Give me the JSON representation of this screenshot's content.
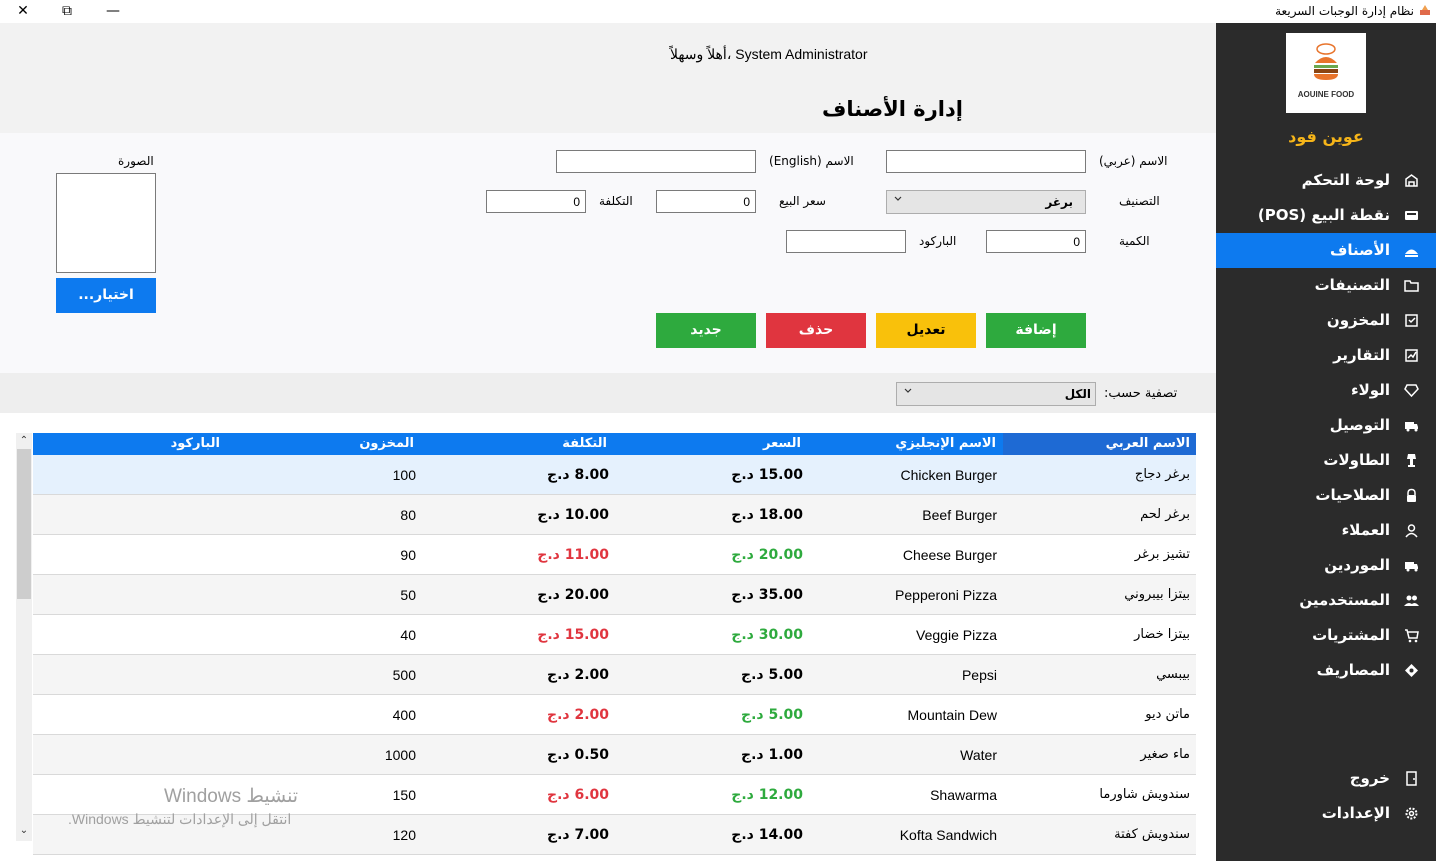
{
  "window": {
    "title": "نظام إدارة الوجبات السريعة",
    "close_glyph": "✕",
    "restore_glyph": "⧉",
    "minimize_glyph": "—"
  },
  "sidebar": {
    "logo_text": "AOUINE FOOD",
    "brand": "عوين فود",
    "items": [
      {
        "label": "لوحة التحكم",
        "icon": "dashboard-icon"
      },
      {
        "label": "نقطة البيع (POS)",
        "icon": "pos-icon"
      },
      {
        "label": "الأصناف",
        "icon": "items-icon"
      },
      {
        "label": "التصنيفات",
        "icon": "folder-icon"
      },
      {
        "label": "المخزون",
        "icon": "inventory-icon"
      },
      {
        "label": "التقارير",
        "icon": "reports-icon"
      },
      {
        "label": "الولاء",
        "icon": "loyalty-icon"
      },
      {
        "label": "التوصيل",
        "icon": "delivery-icon"
      },
      {
        "label": "الطاولات",
        "icon": "tables-icon"
      },
      {
        "label": "الصلاحيات",
        "icon": "lock-icon"
      },
      {
        "label": "العملاء",
        "icon": "customers-icon"
      },
      {
        "label": "الموردين",
        "icon": "suppliers-icon"
      },
      {
        "label": "المستخدمين",
        "icon": "users-icon"
      },
      {
        "label": "المشتريات",
        "icon": "purchases-icon"
      },
      {
        "label": "المصاريف",
        "icon": "expenses-icon"
      }
    ],
    "logout": "خروج",
    "settings": "الإعدادات",
    "active_color": "#0d7aef",
    "brand_color": "#f6b519"
  },
  "header": {
    "welcome": "أهلاً وسهلاً، System Administrator",
    "page_title": "إدارة الأصناف"
  },
  "form": {
    "name_ar_label": "الاسم (عربي)",
    "name_ar_value": "",
    "name_en_label": "الاسم (English)",
    "name_en_value": "",
    "category_label": "التصنيف",
    "category_value": "برغر",
    "price_label": "سعر البيع",
    "price_value": "0",
    "cost_label": "التكلفة",
    "cost_value": "0",
    "qty_label": "الكمية",
    "qty_value": "0",
    "barcode_label": "الباركود",
    "barcode_value": "",
    "image_label": "الصورة",
    "choose_button": "اختيار...",
    "add_button": "إضافة",
    "edit_button": "تعديل",
    "delete_button": "حذف",
    "new_button": "جديد"
  },
  "filter": {
    "label": "تصفية حسب:",
    "value": "الكل"
  },
  "grid": {
    "columns": [
      "الاسم العربي",
      "الاسم الإنجليزي",
      "السعر",
      "التكلفة",
      "المخزون",
      "الباركود"
    ],
    "rows": [
      {
        "ar": "برغر دجاج",
        "en": "Chicken Burger",
        "price": "15.00 د.ج",
        "cost": "8.00 د.ج",
        "stock": "100",
        "barcode": "",
        "price_color": "#000000",
        "cost_color": "#000000"
      },
      {
        "ar": "برغر لحم",
        "en": "Beef Burger",
        "price": "18.00 د.ج",
        "cost": "10.00 د.ج",
        "stock": "80",
        "barcode": "",
        "price_color": "#000000",
        "cost_color": "#000000"
      },
      {
        "ar": "تشيز برغر",
        "en": "Cheese Burger",
        "price": "20.00 د.ج",
        "cost": "11.00 د.ج",
        "stock": "90",
        "barcode": "",
        "price_color": "#2eaa3e",
        "cost_color": "#e0353f"
      },
      {
        "ar": "بيتزا بيبروني",
        "en": "Pepperoni Pizza",
        "price": "35.00 د.ج",
        "cost": "20.00 د.ج",
        "stock": "50",
        "barcode": "",
        "price_color": "#000000",
        "cost_color": "#000000"
      },
      {
        "ar": "بيتزا خضار",
        "en": "Veggie Pizza",
        "price": "30.00 د.ج",
        "cost": "15.00 د.ج",
        "stock": "40",
        "barcode": "",
        "price_color": "#2eaa3e",
        "cost_color": "#e0353f"
      },
      {
        "ar": "بيبسي",
        "en": "Pepsi",
        "price": "5.00 د.ج",
        "cost": "2.00 د.ج",
        "stock": "500",
        "barcode": "",
        "price_color": "#000000",
        "cost_color": "#000000"
      },
      {
        "ar": "ماتن ديو",
        "en": "Mountain Dew",
        "price": "5.00 د.ج",
        "cost": "2.00 د.ج",
        "stock": "400",
        "barcode": "",
        "price_color": "#2eaa3e",
        "cost_color": "#e0353f"
      },
      {
        "ar": "ماء صغير",
        "en": "Water",
        "price": "1.00 د.ج",
        "cost": "0.50 د.ج",
        "stock": "1000",
        "barcode": "",
        "price_color": "#000000",
        "cost_color": "#000000"
      },
      {
        "ar": "سندويش شاورما",
        "en": "Shawarma",
        "price": "12.00 د.ج",
        "cost": "6.00 د.ج",
        "stock": "150",
        "barcode": "",
        "price_color": "#2eaa3e",
        "cost_color": "#e0353f"
      },
      {
        "ar": "سندويش كفتة",
        "en": "Kofta Sandwich",
        "price": "14.00 د.ج",
        "cost": "7.00 د.ج",
        "stock": "120",
        "barcode": "",
        "price_color": "#000000",
        "cost_color": "#000000"
      }
    ],
    "header_color": "#0d7aef",
    "selected_row_color": "#e5f1fd",
    "alt_row_color": "#f5f5f5"
  },
  "watermark": {
    "line1": "تنشيط Windows",
    "line2": "انتقل إلى الإعدادات لتنشيط Windows."
  },
  "buttons_colors": {
    "add": "#2eaa3e",
    "edit": "#f9c10b",
    "delete": "#e0353f",
    "new": "#2eaa3e",
    "choose": "#0d7aef"
  }
}
